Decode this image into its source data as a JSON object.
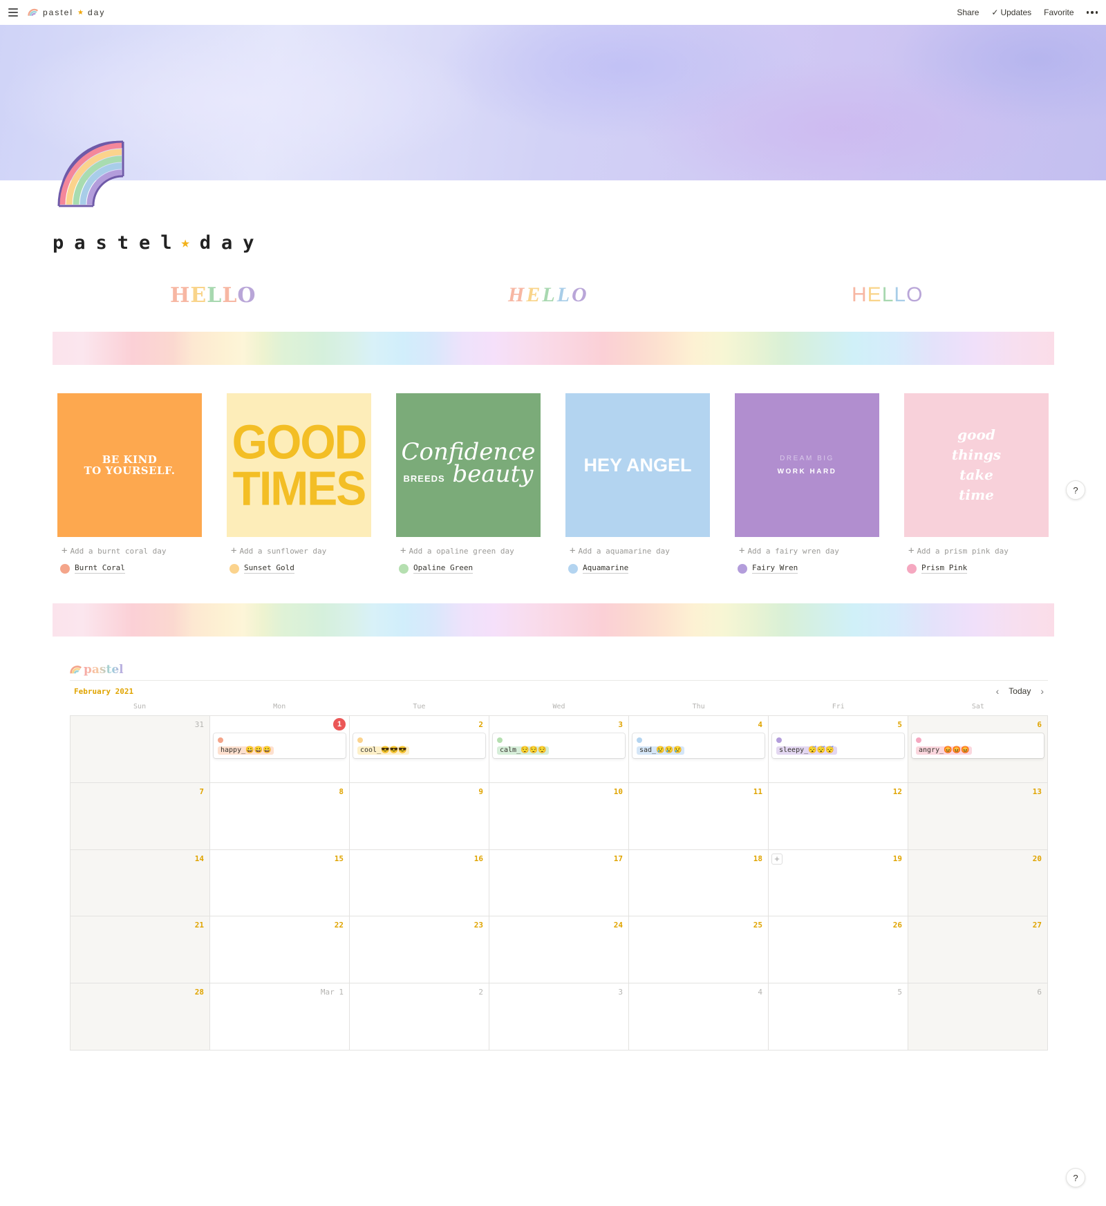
{
  "topbar": {
    "breadcrumb": "pastel",
    "breadcrumb_after": "day",
    "share": "Share",
    "updates": "Updates",
    "favorite": "Favorite"
  },
  "page": {
    "title_before": "pastel",
    "title_after": "day",
    "title_star": "★"
  },
  "hellos": [
    {
      "letters": [
        "H",
        "E",
        "L",
        "L",
        "O"
      ],
      "colors": [
        "#f7b7a3",
        "#f9d48a",
        "#a8d8b0",
        "#f7b7a3",
        "#b9a6d8"
      ]
    },
    {
      "letters": [
        "H",
        "E",
        "L",
        "L",
        "O"
      ],
      "colors": [
        "#f7b7a3",
        "#f9d48a",
        "#a8d8b0",
        "#a8cde8",
        "#b9a6d8"
      ]
    },
    {
      "letters": [
        "H",
        "E",
        "L",
        "L",
        "O"
      ],
      "colors": [
        "#f7b7a3",
        "#f9d48a",
        "#a8d8b0",
        "#a8cde8",
        "#b9a6d8"
      ]
    }
  ],
  "gallery": [
    {
      "cover_text": [
        "BE KIND",
        "TO YOURSELF."
      ],
      "add_label": "Add a burnt coral day",
      "tag": "Burnt Coral",
      "tag_color": "#f4a58a"
    },
    {
      "cover_text": [
        "GOOD",
        "TIMES"
      ],
      "add_label": "Add a sunflower day",
      "tag": "Sunset Gold",
      "tag_color": "#fbd38d"
    },
    {
      "cover_text": [
        "Confidence",
        "BREEDS",
        "beauty"
      ],
      "add_label": "Add a opaline green day",
      "tag": "Opaline Green",
      "tag_color": "#b5dfb0"
    },
    {
      "cover_text": [
        "HEY ANGEL"
      ],
      "add_label": "Add a aquamarine day",
      "tag": "Aquamarine",
      "tag_color": "#b3d4f0"
    },
    {
      "cover_text": [
        "DREAM BIG",
        "WORK HARD"
      ],
      "add_label": "Add a fairy wren day",
      "tag": "Fairy Wren",
      "tag_color": "#b39ddb"
    },
    {
      "cover_text": [
        "good",
        "things",
        "take",
        "time"
      ],
      "add_label": "Add a prism pink day",
      "tag": "Prism Pink",
      "tag_color": "#f5a8c0"
    }
  ],
  "calendar": {
    "title": "pastel",
    "month": "February 2021",
    "today_label": "Today",
    "weekdays": [
      "Sun",
      "Mon",
      "Tue",
      "Wed",
      "Thu",
      "Fri",
      "Sat"
    ],
    "weeks": [
      [
        {
          "day": "31",
          "muted": true
        },
        {
          "day": "1",
          "today": true,
          "event": {
            "dot": "#f4a58a",
            "mood": "happy_😀😀😀",
            "bg": "#fde0cf"
          }
        },
        {
          "day": "2",
          "event": {
            "dot": "#fbd38d",
            "mood": "cool_😎😎😎",
            "bg": "#fdf0c8"
          }
        },
        {
          "day": "3",
          "event": {
            "dot": "#b5dfb0",
            "mood": "calm_😌😌😌",
            "bg": "#d6eed9"
          }
        },
        {
          "day": "4",
          "event": {
            "dot": "#b3d4f0",
            "mood": "sad_😢😢😢",
            "bg": "#d5e6f7"
          }
        },
        {
          "day": "5",
          "event": {
            "dot": "#b39ddb",
            "mood": "sleepy_😴😴😴",
            "bg": "#e3d7f1"
          }
        },
        {
          "day": "6",
          "event": {
            "dot": "#f5a8c0",
            "mood": "angry_😡😡😡",
            "bg": "#fbd7de"
          }
        }
      ],
      [
        {
          "day": "7"
        },
        {
          "day": "8"
        },
        {
          "day": "9"
        },
        {
          "day": "10"
        },
        {
          "day": "11"
        },
        {
          "day": "12"
        },
        {
          "day": "13"
        }
      ],
      [
        {
          "day": "14"
        },
        {
          "day": "15"
        },
        {
          "day": "16"
        },
        {
          "day": "17"
        },
        {
          "day": "18"
        },
        {
          "day": "19",
          "add": true
        },
        {
          "day": "20"
        }
      ],
      [
        {
          "day": "21"
        },
        {
          "day": "22"
        },
        {
          "day": "23"
        },
        {
          "day": "24"
        },
        {
          "day": "25"
        },
        {
          "day": "26"
        },
        {
          "day": "27"
        }
      ],
      [
        {
          "day": "28"
        },
        {
          "day": "Mar 1",
          "muted": true
        },
        {
          "day": "2",
          "muted": true
        },
        {
          "day": "3",
          "muted": true
        },
        {
          "day": "4",
          "muted": true
        },
        {
          "day": "5",
          "muted": true
        },
        {
          "day": "6",
          "muted": true
        }
      ]
    ]
  },
  "help_label": "?"
}
